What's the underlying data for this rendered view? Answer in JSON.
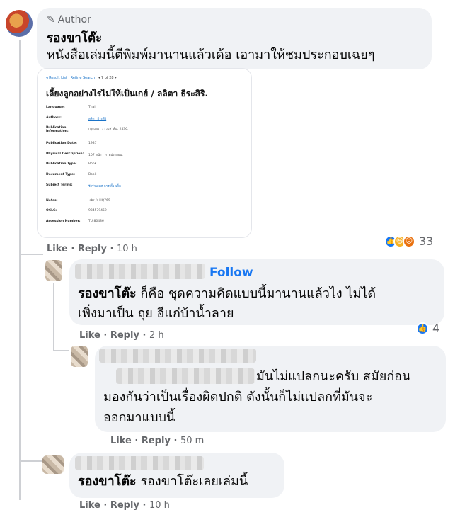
{
  "post_comment": {
    "author_badge": "Author",
    "name": "รองขาโต๊ะ",
    "text": "หนังสือเล่มนี้ตีพิมพ์มานานแล้วเด้อ เอามาให้ชมประกอบเฉยๆ",
    "actions": {
      "like": "Like",
      "reply": "Reply",
      "time": "10 h"
    },
    "reaction_count": "33"
  },
  "book_card": {
    "nav_result_list": "◂ Result List",
    "nav_refine": "Refine Search",
    "nav_position": "◂ 7 of 28 ▸",
    "title": "เลี้ยงลูกอย่างไรไม่ให้เป็นเกย์ / ลลิตา ธีระสิริ.",
    "fields": [
      {
        "key": "Language:",
        "value": "Thai"
      },
      {
        "key": "Authors:",
        "value": "ลลิตา ธีระสิริ"
      },
      {
        "key": "Publication Information:",
        "value": "กรุงเทพฯ : รวมสาส์น, 2536."
      },
      {
        "key": "Publication Date:",
        "value": "1987"
      },
      {
        "key": "Physical Description:",
        "value": "107 หน้า : ภาพประกอบ."
      },
      {
        "key": "Publication Type:",
        "value": "Book"
      },
      {
        "key": "Document Type:",
        "value": "Book"
      },
      {
        "key": "Subject Terms:",
        "value": "รักร่วมเพศ การเลี้ยงเด็ก"
      },
      {
        "key": "Notes:",
        "value": "<br />HQ769"
      },
      {
        "key": "OCLC:",
        "value": "934579459"
      },
      {
        "key": "Accession Number:",
        "value": "TU.80486"
      }
    ]
  },
  "reply1": {
    "follow": "Follow",
    "name": "รองขาโต๊ะ",
    "text_line1": "ก็คือ ชุดความคิดแบบนี้มานานแล้วไง ไม่ได้",
    "text_line2": "เพิ่งมาเป็น ถุย อีแก่บ้าน้ำลาย",
    "actions": {
      "like": "Like",
      "reply": "Reply",
      "time": "2 h"
    },
    "reaction_count": "4"
  },
  "reply2": {
    "text_line1": "มันไม่แปลกนะครับ สมัยก่อน",
    "text_line2": "มองกันว่าเป็นเรื่องผิดปกติ ดังนั้นก็ไม่แปลกที่มันจะ",
    "text_line3": "ออกมาแบบนี้",
    "actions": {
      "like": "Like",
      "reply": "Reply",
      "time": "50 m"
    }
  },
  "reply3": {
    "name": "รองขาโต๊ะ",
    "text": "รองขาโต๊ะเลยเล่มนี้",
    "actions": {
      "like": "Like",
      "reply": "Reply",
      "time": "10 h"
    }
  },
  "colors": {
    "link": "#1877f2",
    "bubble": "#f0f2f5",
    "meta": "#65676b"
  }
}
